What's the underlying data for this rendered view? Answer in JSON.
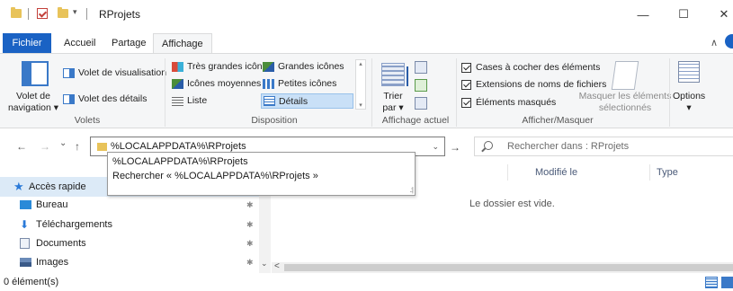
{
  "window": {
    "title": "RProjets",
    "minimize": "—",
    "maximize": "☐",
    "close": "✕"
  },
  "ribbon_tabs": {
    "file": "Fichier",
    "home": "Accueil",
    "share": "Partage",
    "view": "Affichage",
    "collapse": "∧"
  },
  "ribbon": {
    "panes": {
      "nav_pane_line1": "Volet de",
      "nav_pane_line2": "navigation ▾",
      "preview_pane": "Volet de visualisation",
      "details_pane": "Volet des détails",
      "group_label": "Volets"
    },
    "layout": {
      "extra_large": "Très grandes icônes",
      "large": "Grandes icônes",
      "medium": "Icônes moyennes",
      "small": "Petites icônes",
      "list": "Liste",
      "details": "Détails",
      "group_label": "Disposition"
    },
    "current_view": {
      "sort_line1": "Trier",
      "sort_line2": "par ▾",
      "group_label": "Affichage actuel"
    },
    "show_hide": {
      "checkboxes": "Cases à cocher des éléments",
      "extensions": "Extensions de noms de fichiers",
      "hidden": "Éléments masqués",
      "hide_selected_line1": "Masquer les éléments",
      "hide_selected_line2": "sélectionnés",
      "group_label": "Afficher/Masquer"
    },
    "options": {
      "label": "Options",
      "arrow": "▾"
    }
  },
  "address": {
    "back": "←",
    "forward": "→",
    "recent": "⌄",
    "up": "↑",
    "path": "%LOCALAPPDATA%\\RProjets",
    "dropdown": "⌄",
    "go": "→",
    "search_placeholder": "Rechercher dans : RProjets"
  },
  "autocomplete": {
    "items": [
      "%LOCALAPPDATA%\\RProjets",
      "Rechercher « %LOCALAPPDATA%\\RProjets »"
    ]
  },
  "navigation": {
    "items": [
      {
        "label": "Accès rapide"
      },
      {
        "label": "Bureau"
      },
      {
        "label": "Téléchargements"
      },
      {
        "label": "Documents"
      },
      {
        "label": "Images"
      }
    ],
    "pin": "✱"
  },
  "content": {
    "columns": [
      "Modifié le",
      "Type"
    ],
    "empty_message": "Le dossier est vide.",
    "scroll_left": "<",
    "scroll_down": "⌄"
  },
  "status": {
    "count": "0 élément(s)"
  }
}
